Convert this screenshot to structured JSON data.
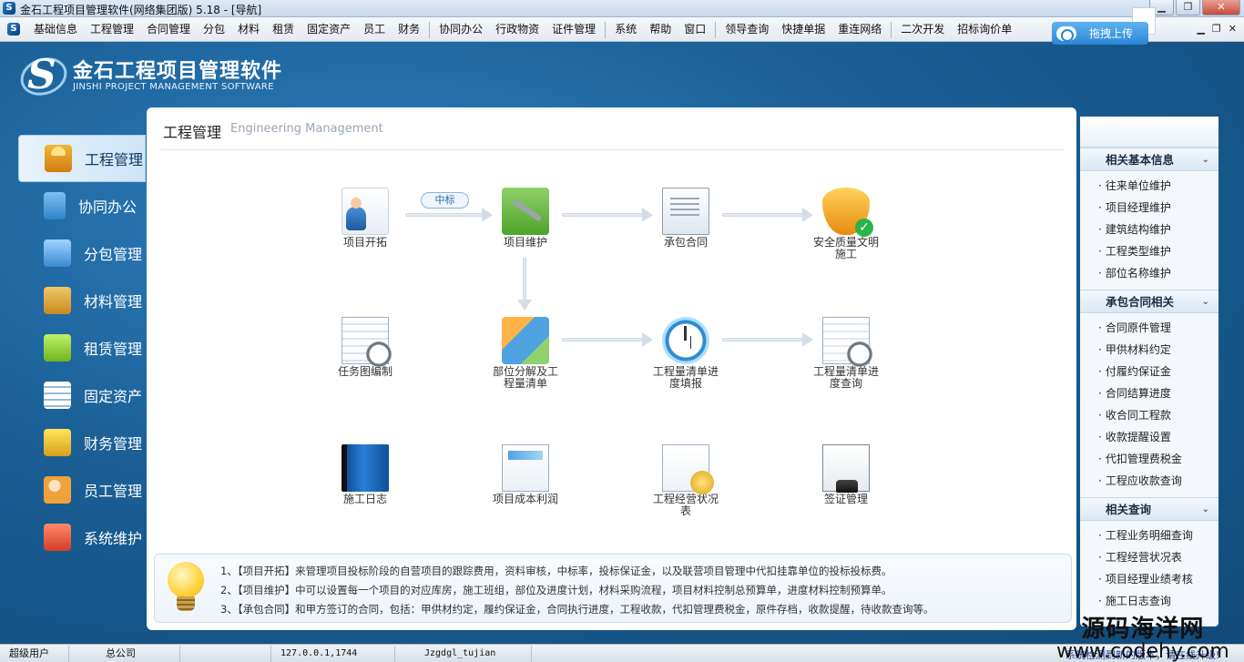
{
  "window": {
    "title": "金石工程项目管理软件(网络集团版) 5.18 - [导航]"
  },
  "menubar": {
    "items": [
      "基础信息",
      "工程管理",
      "合同管理",
      "分包",
      "材料",
      "租赁",
      "固定资产",
      "员工",
      "财务",
      "协同办公",
      "行政物资",
      "证件管理",
      "系统",
      "帮助",
      "窗口",
      "领导查询",
      "快捷单据",
      "重连网络",
      "二次开发",
      "招标询价单"
    ]
  },
  "upload": {
    "label": "拖拽上传"
  },
  "logo": {
    "cn": "金石工程项目管理软件",
    "en": "JINSHI PROJECT MANAGEMENT SOFTWARE"
  },
  "nav": {
    "items": [
      {
        "label": "工程管理",
        "icon": "engineer-icon"
      },
      {
        "label": "协同办公",
        "icon": "coop-icon"
      },
      {
        "label": "分包管理",
        "icon": "subcontract-icon"
      },
      {
        "label": "材料管理",
        "icon": "material-box-icon"
      },
      {
        "label": "租赁管理",
        "icon": "rent-cube-icon"
      },
      {
        "label": "固定资产",
        "icon": "asset-list-icon"
      },
      {
        "label": "财务管理",
        "icon": "money-icon"
      },
      {
        "label": "员工管理",
        "icon": "staff-icon"
      },
      {
        "label": "系统维护",
        "icon": "system-tool-icon"
      }
    ]
  },
  "main": {
    "title": "工程管理",
    "subtitle": "Engineering Management",
    "pill": "中标",
    "nodes": {
      "kaituo": "项目开拓",
      "weihu": "项目维护",
      "hetong": "承包合同",
      "anquan1": "安全质量文明",
      "anquan2": "施工",
      "renwu": "任务图编制",
      "bufen1": "部位分解及工",
      "bufen2": "程量清单",
      "tianbao1": "工程量清单进",
      "tianbao2": "度填报",
      "chaxun1": "工程量清单进",
      "chaxun2": "度查询",
      "rizhi": "施工日志",
      "chengben": "项目成本利润",
      "jingying1": "工程经营状况",
      "jingying2": "表",
      "qianzheng": "签证管理"
    },
    "tips": [
      "1、【项目开拓】来管理项目投标阶段的自营项目的跟踪费用，资料审核，中标率，投标保证金，以及联营项目管理中代扣挂靠单位的投标投标费。",
      "2、【项目维护】中可以设置每一个项目的对应库房，施工班组，部位及进度计划，材料采购流程，项目材料控制总预算单，进度材料控制预算单。",
      "3、【承包合同】和甲方签订的合同，包括：甲供材约定，履约保证金，合同执行进度，工程收款，代扣管理费税金，原件存档，收款提醒，待收款查询等。"
    ]
  },
  "right": {
    "sections": [
      {
        "title": "相关基本信息",
        "items": [
          "往来单位维护",
          "项目经理维护",
          "建筑结构维护",
          "工程类型维护",
          "部位名称维护"
        ]
      },
      {
        "title": "承包合同相关",
        "items": [
          "合同原件管理",
          "甲供材料约定",
          "付履约保证金",
          "合同结算进度",
          "收合同工程款",
          "收款提醒设置",
          "代扣管理费税金",
          "工程应收款查询"
        ]
      },
      {
        "title": "相关查询",
        "items": [
          "工程业务明细查询",
          "工程经营状况表",
          "项目经理业绩考核",
          "施工日志查询"
        ]
      }
    ]
  },
  "status": {
    "user": "超级用户",
    "company": "总公司",
    "ip": "127.0.0.1,1744",
    "db": "Jzgdgl_tujian",
    "scroll": "系统检测到新的版本，请在线升级!"
  },
  "watermark": {
    "line1": "源码海洋网",
    "line2": "www.codehy.com"
  }
}
